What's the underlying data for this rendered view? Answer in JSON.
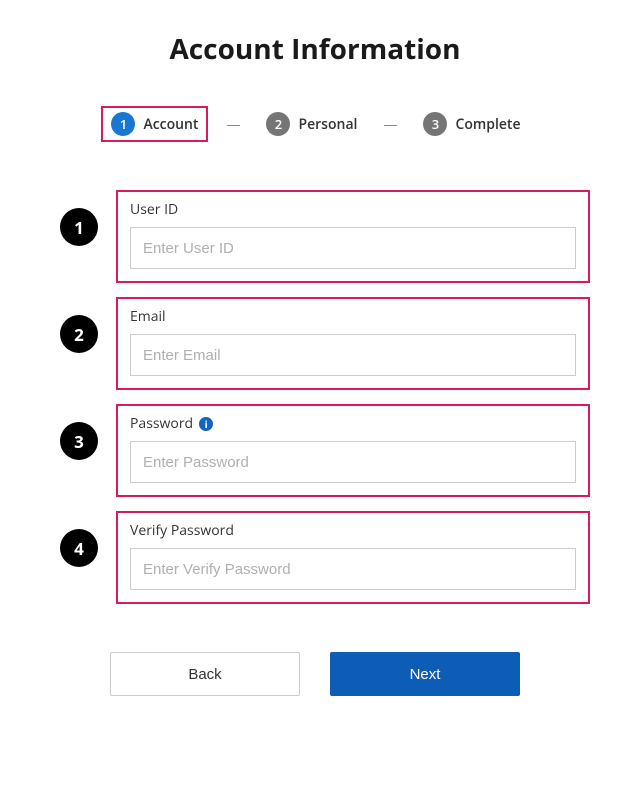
{
  "title": "Account Information",
  "stepper": {
    "steps": [
      {
        "num": "1",
        "label": "Account",
        "active": true,
        "highlighted": true
      },
      {
        "num": "2",
        "label": "Personal",
        "active": false,
        "highlighted": false
      },
      {
        "num": "3",
        "label": "Complete",
        "active": false,
        "highlighted": false
      }
    ],
    "separator": "—"
  },
  "annotations": {
    "n1": "1",
    "n2": "2",
    "n3": "3",
    "n4": "4"
  },
  "fields": {
    "userId": {
      "label": "User ID",
      "placeholder": "Enter User ID",
      "info": false
    },
    "email": {
      "label": "Email",
      "placeholder": "Enter Email",
      "info": false
    },
    "password": {
      "label": "Password",
      "placeholder": "Enter Password",
      "info": true
    },
    "verifyPassword": {
      "label": "Verify Password",
      "placeholder": "Enter Verify Password",
      "info": false
    }
  },
  "buttons": {
    "back": "Back",
    "next": "Next"
  }
}
